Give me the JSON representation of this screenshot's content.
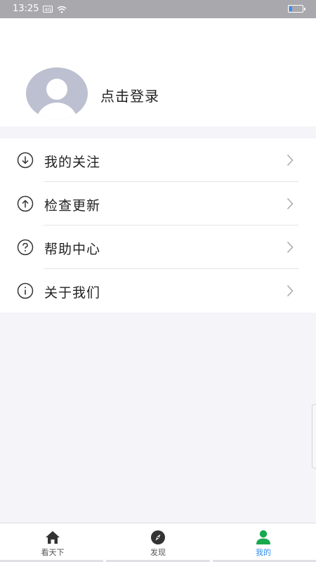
{
  "status_bar": {
    "time": "13:25",
    "sim_label": "4G",
    "battery_level": 0.2,
    "battery_color": "#3a8df0"
  },
  "profile": {
    "avatar_icon": "default-user-avatar-icon",
    "login_label": "点击登录"
  },
  "menu": {
    "items": [
      {
        "label": "我的关注",
        "icon": "download-circle-icon"
      },
      {
        "label": "检查更新",
        "icon": "upload-circle-icon"
      },
      {
        "label": "帮助中心",
        "icon": "question-circle-icon"
      },
      {
        "label": "关于我们",
        "icon": "info-circle-icon"
      }
    ]
  },
  "tabbar": {
    "tabs": [
      {
        "label": "看天下",
        "icon": "home-icon",
        "active": false
      },
      {
        "label": "发现",
        "icon": "compass-icon",
        "active": false
      },
      {
        "label": "我的",
        "icon": "user-icon",
        "active": true
      }
    ],
    "active_color": "#2d8cf0",
    "active_icon_color": "#1aa84f"
  }
}
